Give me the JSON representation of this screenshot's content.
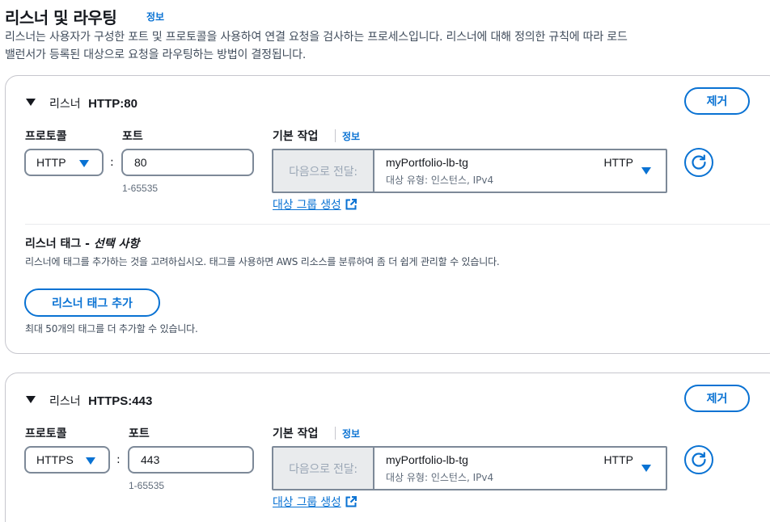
{
  "header": {
    "title": "리스너 및 라우팅",
    "info": "정보",
    "description_line1": "리스너는 사용자가 구성한 포트 및 프로토콜을 사용하여 연결 요청을 검사하는 프로세스입니다. 리스너에 대해 정의한 규칙에 따라 로드",
    "description_line2": "밸런서가 등록된 대상으로 요청을 라우팅하는 방법이 결정됩니다."
  },
  "listeners": [
    {
      "title_prefix": "리스너",
      "title_value": "HTTP:80",
      "remove_label": "제거",
      "protocol_label": "프로토콜",
      "protocol_value": "HTTP",
      "port_label": "포트",
      "port_value": "80",
      "port_range": "1-65535",
      "separator": ":",
      "default_action_label": "기본 작업",
      "default_action_info": "정보",
      "forward_prefix": "다음으로 전달:",
      "target_group_name": "myPortfolio-lb-tg",
      "target_group_protocol": "HTTP",
      "target_group_type": "대상 유형: 인스턴스, IPv4",
      "create_target_group": "대상 그룹 생성",
      "tags": {
        "title": "리스너 태그 - ",
        "title_optional": "선택 사항",
        "description": "리스너에 태그를 추가하는 것을 고려하십시오. 태그를 사용하면 AWS 리소스를 분류하여 좀 더 쉽게 관리할 수 있습니다.",
        "add_button": "리스너 태그 추가",
        "limit_text": "최대 50개의 태그를 더 추가할 수 있습니다."
      }
    },
    {
      "title_prefix": "리스너",
      "title_value": "HTTPS:443",
      "remove_label": "제거",
      "protocol_label": "프로토콜",
      "protocol_value": "HTTPS",
      "port_label": "포트",
      "port_value": "443",
      "port_range": "1-65535",
      "separator": ":",
      "default_action_label": "기본 작업",
      "default_action_info": "정보",
      "forward_prefix": "다음으로 전달:",
      "target_group_name": "myPortfolio-lb-tg",
      "target_group_protocol": "HTTP",
      "target_group_type": "대상 유형: 인스턴스, IPv4",
      "create_target_group": "대상 그룹 생성"
    }
  ],
  "colors": {
    "link": "#0972d3",
    "border": "#7d8998",
    "disabled_bg": "#e9ebed"
  }
}
